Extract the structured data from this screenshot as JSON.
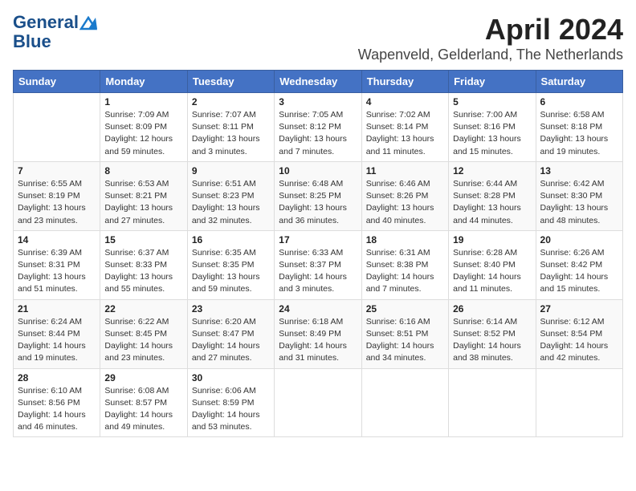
{
  "header": {
    "logo_line1": "General",
    "logo_line2": "Blue",
    "month_year": "April 2024",
    "location": "Wapenveld, Gelderland, The Netherlands"
  },
  "days_of_week": [
    "Sunday",
    "Monday",
    "Tuesday",
    "Wednesday",
    "Thursday",
    "Friday",
    "Saturday"
  ],
  "weeks": [
    [
      {
        "day": "",
        "sunrise": "",
        "sunset": "",
        "daylight": ""
      },
      {
        "day": "1",
        "sunrise": "Sunrise: 7:09 AM",
        "sunset": "Sunset: 8:09 PM",
        "daylight": "Daylight: 12 hours and 59 minutes."
      },
      {
        "day": "2",
        "sunrise": "Sunrise: 7:07 AM",
        "sunset": "Sunset: 8:11 PM",
        "daylight": "Daylight: 13 hours and 3 minutes."
      },
      {
        "day": "3",
        "sunrise": "Sunrise: 7:05 AM",
        "sunset": "Sunset: 8:12 PM",
        "daylight": "Daylight: 13 hours and 7 minutes."
      },
      {
        "day": "4",
        "sunrise": "Sunrise: 7:02 AM",
        "sunset": "Sunset: 8:14 PM",
        "daylight": "Daylight: 13 hours and 11 minutes."
      },
      {
        "day": "5",
        "sunrise": "Sunrise: 7:00 AM",
        "sunset": "Sunset: 8:16 PM",
        "daylight": "Daylight: 13 hours and 15 minutes."
      },
      {
        "day": "6",
        "sunrise": "Sunrise: 6:58 AM",
        "sunset": "Sunset: 8:18 PM",
        "daylight": "Daylight: 13 hours and 19 minutes."
      }
    ],
    [
      {
        "day": "7",
        "sunrise": "Sunrise: 6:55 AM",
        "sunset": "Sunset: 8:19 PM",
        "daylight": "Daylight: 13 hours and 23 minutes."
      },
      {
        "day": "8",
        "sunrise": "Sunrise: 6:53 AM",
        "sunset": "Sunset: 8:21 PM",
        "daylight": "Daylight: 13 hours and 27 minutes."
      },
      {
        "day": "9",
        "sunrise": "Sunrise: 6:51 AM",
        "sunset": "Sunset: 8:23 PM",
        "daylight": "Daylight: 13 hours and 32 minutes."
      },
      {
        "day": "10",
        "sunrise": "Sunrise: 6:48 AM",
        "sunset": "Sunset: 8:25 PM",
        "daylight": "Daylight: 13 hours and 36 minutes."
      },
      {
        "day": "11",
        "sunrise": "Sunrise: 6:46 AM",
        "sunset": "Sunset: 8:26 PM",
        "daylight": "Daylight: 13 hours and 40 minutes."
      },
      {
        "day": "12",
        "sunrise": "Sunrise: 6:44 AM",
        "sunset": "Sunset: 8:28 PM",
        "daylight": "Daylight: 13 hours and 44 minutes."
      },
      {
        "day": "13",
        "sunrise": "Sunrise: 6:42 AM",
        "sunset": "Sunset: 8:30 PM",
        "daylight": "Daylight: 13 hours and 48 minutes."
      }
    ],
    [
      {
        "day": "14",
        "sunrise": "Sunrise: 6:39 AM",
        "sunset": "Sunset: 8:31 PM",
        "daylight": "Daylight: 13 hours and 51 minutes."
      },
      {
        "day": "15",
        "sunrise": "Sunrise: 6:37 AM",
        "sunset": "Sunset: 8:33 PM",
        "daylight": "Daylight: 13 hours and 55 minutes."
      },
      {
        "day": "16",
        "sunrise": "Sunrise: 6:35 AM",
        "sunset": "Sunset: 8:35 PM",
        "daylight": "Daylight: 13 hours and 59 minutes."
      },
      {
        "day": "17",
        "sunrise": "Sunrise: 6:33 AM",
        "sunset": "Sunset: 8:37 PM",
        "daylight": "Daylight: 14 hours and 3 minutes."
      },
      {
        "day": "18",
        "sunrise": "Sunrise: 6:31 AM",
        "sunset": "Sunset: 8:38 PM",
        "daylight": "Daylight: 14 hours and 7 minutes."
      },
      {
        "day": "19",
        "sunrise": "Sunrise: 6:28 AM",
        "sunset": "Sunset: 8:40 PM",
        "daylight": "Daylight: 14 hours and 11 minutes."
      },
      {
        "day": "20",
        "sunrise": "Sunrise: 6:26 AM",
        "sunset": "Sunset: 8:42 PM",
        "daylight": "Daylight: 14 hours and 15 minutes."
      }
    ],
    [
      {
        "day": "21",
        "sunrise": "Sunrise: 6:24 AM",
        "sunset": "Sunset: 8:44 PM",
        "daylight": "Daylight: 14 hours and 19 minutes."
      },
      {
        "day": "22",
        "sunrise": "Sunrise: 6:22 AM",
        "sunset": "Sunset: 8:45 PM",
        "daylight": "Daylight: 14 hours and 23 minutes."
      },
      {
        "day": "23",
        "sunrise": "Sunrise: 6:20 AM",
        "sunset": "Sunset: 8:47 PM",
        "daylight": "Daylight: 14 hours and 27 minutes."
      },
      {
        "day": "24",
        "sunrise": "Sunrise: 6:18 AM",
        "sunset": "Sunset: 8:49 PM",
        "daylight": "Daylight: 14 hours and 31 minutes."
      },
      {
        "day": "25",
        "sunrise": "Sunrise: 6:16 AM",
        "sunset": "Sunset: 8:51 PM",
        "daylight": "Daylight: 14 hours and 34 minutes."
      },
      {
        "day": "26",
        "sunrise": "Sunrise: 6:14 AM",
        "sunset": "Sunset: 8:52 PM",
        "daylight": "Daylight: 14 hours and 38 minutes."
      },
      {
        "day": "27",
        "sunrise": "Sunrise: 6:12 AM",
        "sunset": "Sunset: 8:54 PM",
        "daylight": "Daylight: 14 hours and 42 minutes."
      }
    ],
    [
      {
        "day": "28",
        "sunrise": "Sunrise: 6:10 AM",
        "sunset": "Sunset: 8:56 PM",
        "daylight": "Daylight: 14 hours and 46 minutes."
      },
      {
        "day": "29",
        "sunrise": "Sunrise: 6:08 AM",
        "sunset": "Sunset: 8:57 PM",
        "daylight": "Daylight: 14 hours and 49 minutes."
      },
      {
        "day": "30",
        "sunrise": "Sunrise: 6:06 AM",
        "sunset": "Sunset: 8:59 PM",
        "daylight": "Daylight: 14 hours and 53 minutes."
      },
      {
        "day": "",
        "sunrise": "",
        "sunset": "",
        "daylight": ""
      },
      {
        "day": "",
        "sunrise": "",
        "sunset": "",
        "daylight": ""
      },
      {
        "day": "",
        "sunrise": "",
        "sunset": "",
        "daylight": ""
      },
      {
        "day": "",
        "sunrise": "",
        "sunset": "",
        "daylight": ""
      }
    ]
  ]
}
